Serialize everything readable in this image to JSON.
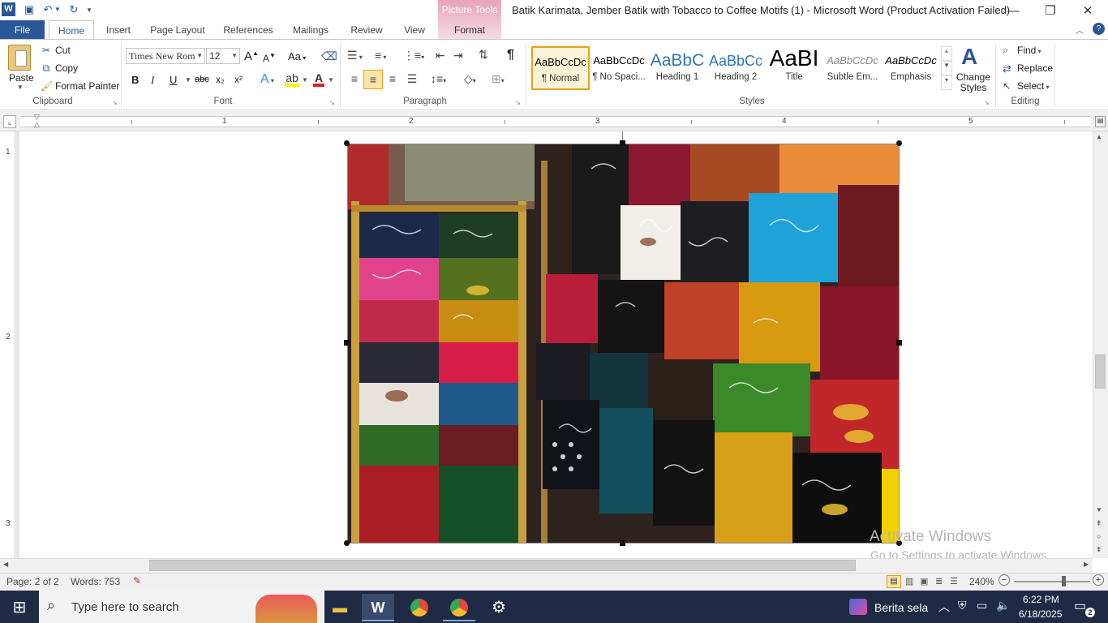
{
  "window": {
    "title": "Batik Karimata, Jember Batik with Tobacco to Coffee Motifs (1)  -  Microsoft Word (Product Activation Failed)",
    "contextual_tab_group": "Picture Tools",
    "accent": "#2b579a",
    "contextual_color": "#e9a3b8"
  },
  "tabs": [
    "File",
    "Home",
    "Insert",
    "Page Layout",
    "References",
    "Mailings",
    "Review",
    "View",
    "Format"
  ],
  "clipboard": {
    "paste": "Paste",
    "cut": "Cut",
    "copy": "Copy",
    "format_painter": "Format Painter",
    "label": "Clipboard"
  },
  "font": {
    "family": "Times New Rom",
    "size": "12",
    "label": "Font",
    "bold": "B",
    "italic": "I",
    "underline": "U",
    "strike": "abc",
    "subscript": "x₂",
    "superscript": "x²",
    "grow": "A",
    "shrink": "A",
    "case": "Aa",
    "effects": "A",
    "highlight_color": "#ffff00",
    "font_color": "#e02020"
  },
  "paragraph": {
    "label": "Paragraph",
    "pilcrow": "¶"
  },
  "styles": {
    "label": "Styles",
    "items": [
      {
        "sample": "AaBbCcDc",
        "name": "¶ Normal"
      },
      {
        "sample": "AaBbCcDc",
        "name": "¶ No Spaci..."
      },
      {
        "sample": "AaBbC",
        "name": "Heading 1"
      },
      {
        "sample": "AaBbCc",
        "name": "Heading 2"
      },
      {
        "sample": "AaBI",
        "name": "Title"
      },
      {
        "sample": "AaBbCcDc",
        "name": "Subtle Em..."
      },
      {
        "sample": "AaBbCcDc",
        "name": "Emphasis"
      }
    ],
    "change_styles": "Change Styles"
  },
  "editing": {
    "label": "Editing",
    "find": "Find",
    "replace": "Replace",
    "select": "Select"
  },
  "ruler": {
    "numbers": [
      "1",
      "2",
      "3",
      "4",
      "5"
    ]
  },
  "vruler": {
    "numbers": [
      "1",
      "2",
      "3"
    ]
  },
  "status": {
    "page": "Page: 2 of 2",
    "words": "Words: 753",
    "zoom": "240%"
  },
  "watermark": {
    "line1": "Activate Windows",
    "line2": "Go to Settings to activate Windows."
  },
  "taskbar": {
    "search_placeholder": "Type here to search",
    "news": "Berita sela",
    "time": "6:22 PM",
    "date": "6/18/2025",
    "notifications": "2"
  }
}
